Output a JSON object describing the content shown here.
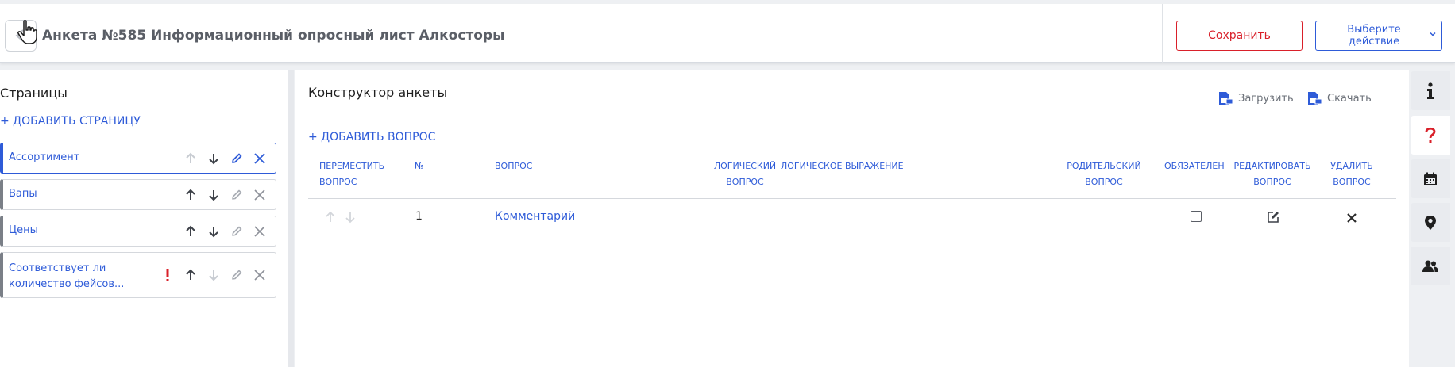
{
  "header": {
    "title": "Анкета №585 Информационный опросный лист Алкосторы",
    "save_label": "Сохранить",
    "action_label_line1": "Выберите",
    "action_label_line2": "действие"
  },
  "pages": {
    "title": "Страницы",
    "add_label": "+ ДОБАВИТЬ СТРАНИЦУ",
    "items": [
      {
        "label": "Ассортимент"
      },
      {
        "label": "Вапы"
      },
      {
        "label": "Цены"
      },
      {
        "label": "Соответствует ли количество фейсов..."
      }
    ]
  },
  "constructor": {
    "title": "Конструктор анкеты",
    "upload_label": "Загрузить",
    "download_label": "Скачать",
    "add_question_label": "+ ДОБАВИТЬ ВОПРОС",
    "columns": {
      "move_line1": "ПЕРЕМЕСТИТЬ",
      "move_line2": "ВОПРОС",
      "number": "№",
      "question": "ВОПРОС",
      "logic_q_line1": "ЛОГИЧЕСКИЙ",
      "logic_q_line2": "ВОПРОС",
      "logic_expr": "ЛОГИЧЕСКОЕ ВЫРАЖЕНИЕ",
      "parent_line1": "РОДИТЕЛЬСКИЙ",
      "parent_line2": "ВОПРОС",
      "required": "ОБЯЗАТЕЛЕН",
      "edit_line1": "РЕДАКТИРОВАТЬ",
      "edit_line2": "ВОПРОС",
      "delete_line1": "УДАЛИТЬ",
      "delete_line2": "ВОПРОС"
    },
    "rows": [
      {
        "number": "1",
        "question": "Комментарий",
        "required": false
      }
    ]
  },
  "colors": {
    "accent": "#2e5bd8",
    "danger": "#d9202a",
    "muted": "#6b7078"
  },
  "rail": {
    "icons": [
      "info-icon",
      "question-icon",
      "calendar-icon",
      "map-pin-icon",
      "users-icon"
    ],
    "active": "question-icon"
  }
}
